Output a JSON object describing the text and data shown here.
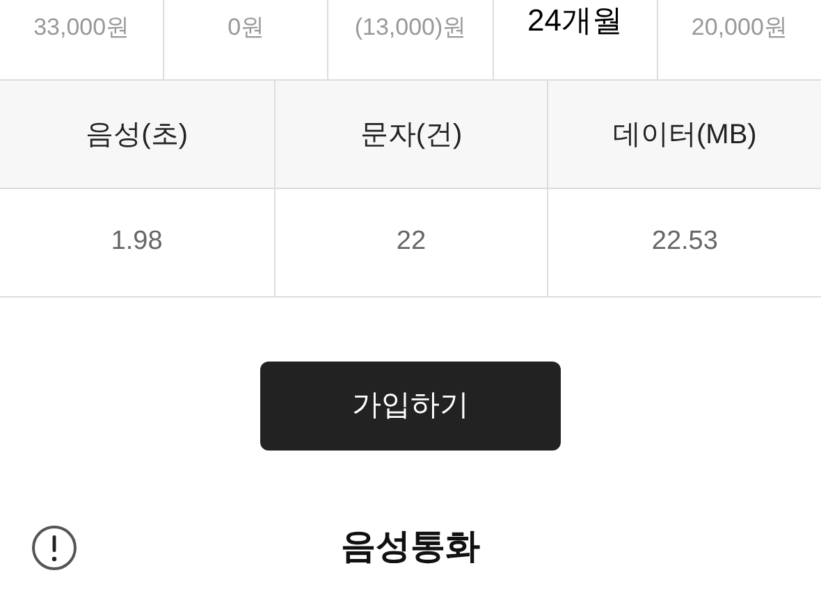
{
  "summary": [
    {
      "value": "33,000원"
    },
    {
      "value": "0원"
    },
    {
      "value": "(13,000)원"
    },
    {
      "value": "24개월",
      "kind": "main"
    },
    {
      "value": "20,000원"
    }
  ],
  "usage_table": {
    "columns": [
      "음성(초)",
      "문자(건)",
      "데이터(MB)"
    ],
    "rows": [
      [
        "1.98",
        "22",
        "22.53"
      ]
    ]
  },
  "join_button": "가입하기",
  "section": {
    "title": "음성통화"
  }
}
